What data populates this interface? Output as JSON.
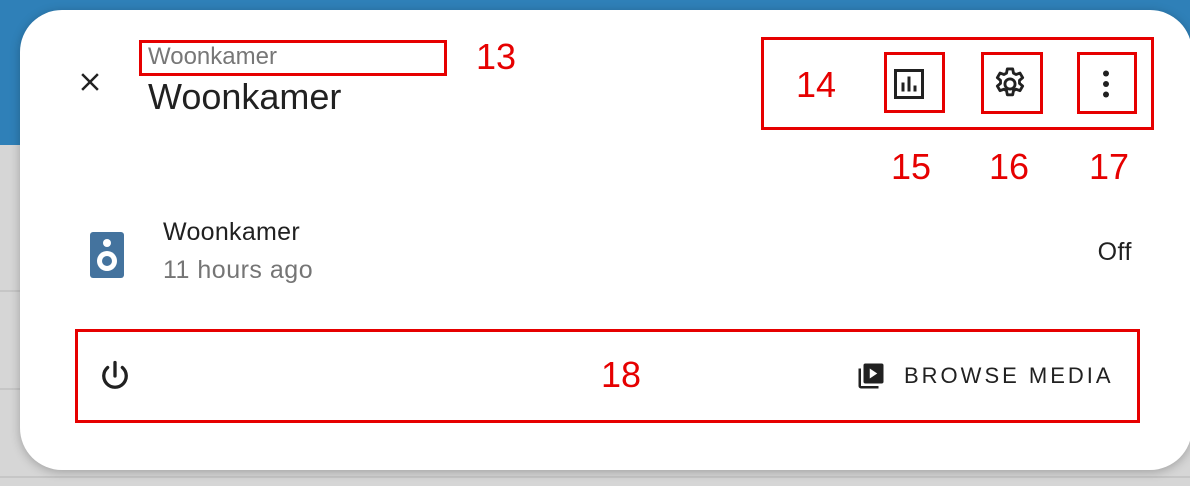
{
  "header": {
    "breadcrumb": "Woonkamer",
    "title": "Woonkamer",
    "icons": [
      "close-icon",
      "history-chart-icon",
      "settings-gear-icon",
      "more-vertical-icon"
    ]
  },
  "entity": {
    "name": "Woonkamer",
    "last_changed": "11 hours ago",
    "state": "Off",
    "icon": "speaker-icon",
    "icon_color": "#44739e"
  },
  "controls": {
    "power_icon": "power-icon",
    "browse_label": "BROWSE MEDIA",
    "browse_icon": "play-box-multiple-icon"
  },
  "annotations": {
    "breadcrumb": "13",
    "header_actions": "14",
    "history": "15",
    "settings": "16",
    "more": "17",
    "controls_bar": "18"
  },
  "colors": {
    "annotation": "#e60000",
    "header_bg": "#2f80b8",
    "text_primary": "#212121",
    "text_secondary": "#757575"
  }
}
